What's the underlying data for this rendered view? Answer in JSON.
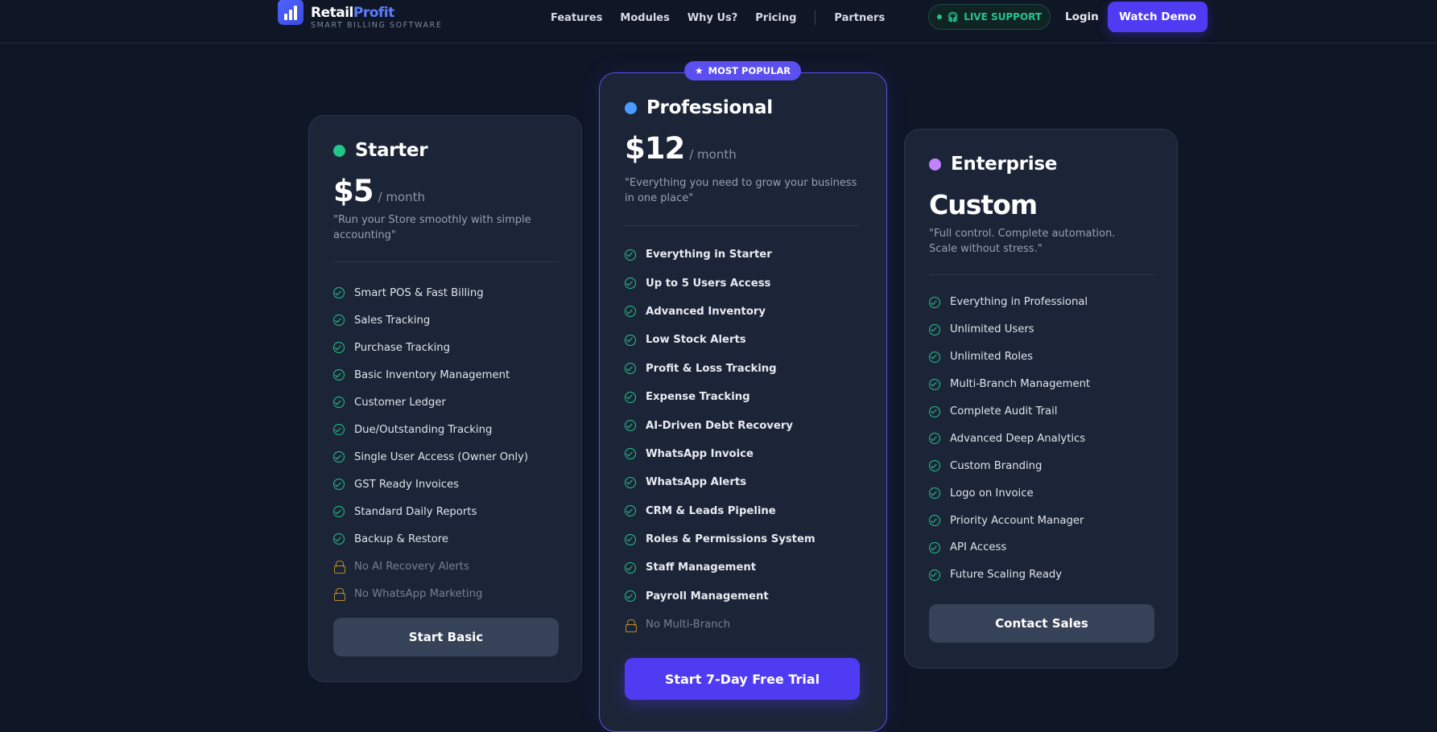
{
  "colors": {
    "background": "#0f1626",
    "accent": "#4f3cf2",
    "check_green": "#22c58a",
    "highlight_orange": "#f5a623",
    "starter_dot": "#22c58a",
    "professional_dot": "#4a9cff",
    "enterprise_dot": "#c084fc"
  },
  "brand": {
    "name_part1": "Retail",
    "name_part2": "Profit",
    "subtitle": "SMART BILLING SOFTWARE"
  },
  "nav": {
    "links": [
      "Features",
      "Modules",
      "Why Us?",
      "Pricing"
    ],
    "secondary_link": "Partners",
    "live_support": "LIVE SUPPORT",
    "login": "Login",
    "watch_demo": "Watch Demo"
  },
  "plans": {
    "starter": {
      "name": "Starter",
      "price": "$5",
      "period": "/ month",
      "tagline": "\"Run your Store smoothly with simple accounting\"",
      "features": [
        "Smart POS & Fast Billing",
        "Sales Tracking",
        "Purchase Tracking",
        "Basic Inventory Management",
        "Customer Ledger",
        "Due/Outstanding Tracking",
        "Single User Access (Owner Only)",
        "GST Ready Invoices",
        "Standard Daily Reports",
        "Backup & Restore"
      ],
      "locked": [
        "No AI Recovery Alerts",
        "No WhatsApp Marketing"
      ],
      "cta": "Start Basic"
    },
    "professional": {
      "badge": "MOST POPULAR",
      "name": "Professional",
      "price": "$12",
      "period": "/ month",
      "tagline": "\"Everything you need to grow your business in one place\"",
      "features": [
        "Everything in Starter",
        "Up to 5 Users Access",
        "Advanced Inventory",
        "Low Stock Alerts",
        "Profit & Loss Tracking",
        "Expense Tracking",
        "AI-Driven Debt Recovery",
        "WhatsApp Invoice",
        "WhatsApp Alerts",
        "CRM & Leads Pipeline",
        "Roles & Permissions System",
        "Staff Management",
        "Payroll Management"
      ],
      "locked": [
        "No Multi-Branch"
      ],
      "cta": "Start 7-Day Free Trial"
    },
    "enterprise": {
      "name": "Enterprise",
      "price": "Custom",
      "tagline": "\"Full control. Complete automation. Scale without stress.\"",
      "features": [
        "Everything in Professional",
        "Unlimited Users",
        "Unlimited Roles",
        "Multi-Branch Management",
        "Complete Audit Trail",
        "Advanced Deep Analytics",
        "Custom Branding",
        "Logo on Invoice",
        "Priority Account Manager",
        "API Access",
        "Future Scaling Ready"
      ],
      "cta": "Contact Sales"
    }
  }
}
